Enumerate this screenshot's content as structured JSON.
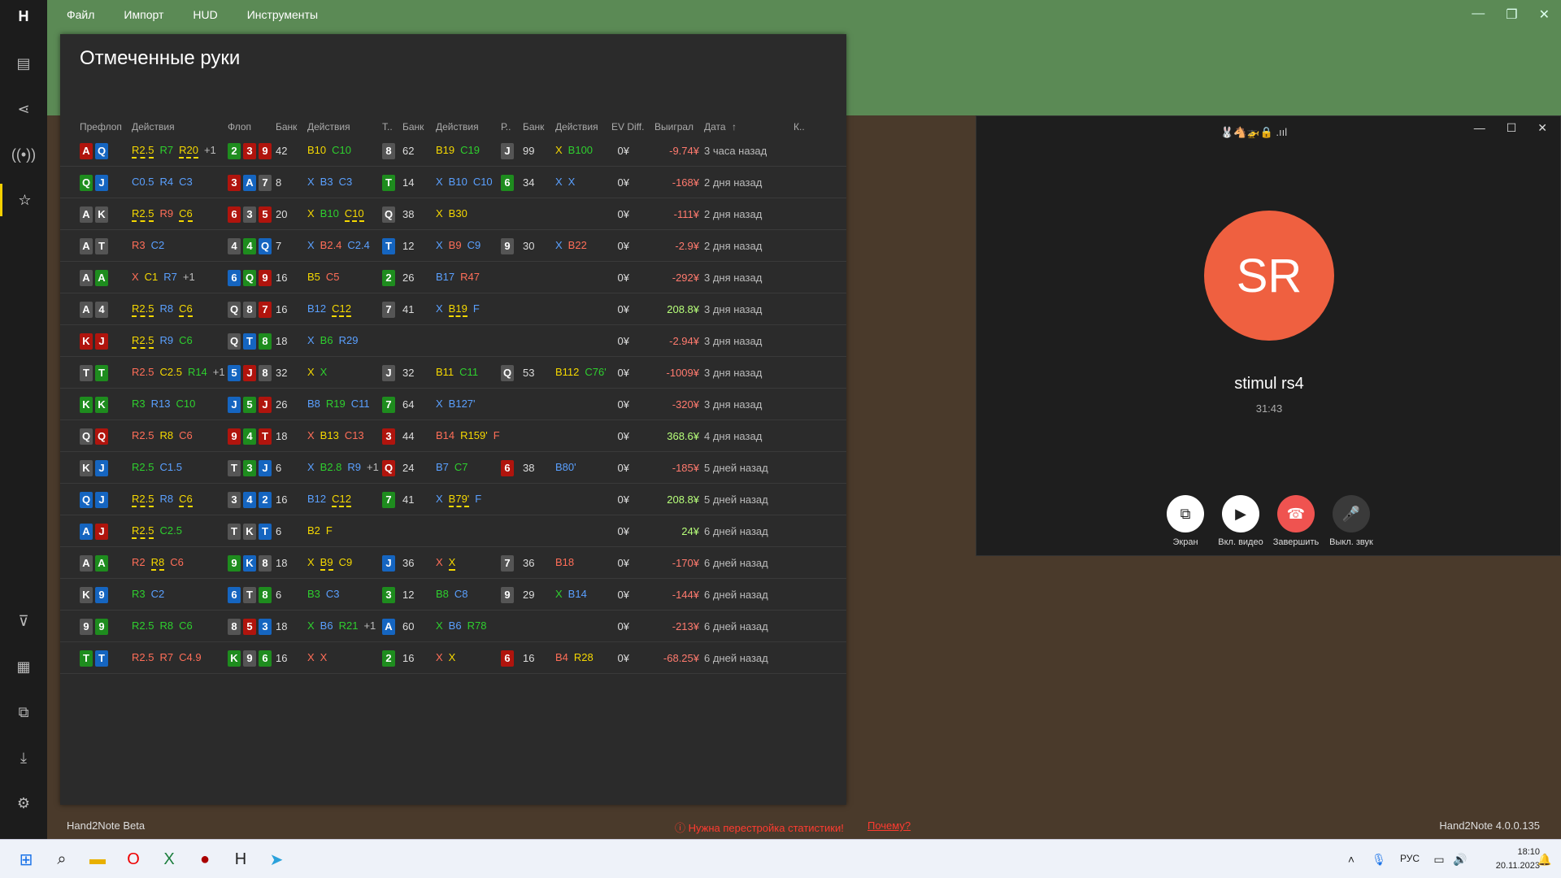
{
  "menu": [
    "Файл",
    "Импорт",
    "HUD",
    "Инструменты"
  ],
  "panel_title": "Отмеченные руки",
  "headers": {
    "preflop": "Префлоп",
    "actions": "Действия",
    "flop": "Флоп",
    "pot": "Банк",
    "t": "Т..",
    "r": "Р..",
    "ev": "EV Diff.",
    "won": "Выиграл",
    "date": "Дата",
    "k": "К.."
  },
  "rows": [
    {
      "hole": [
        [
          "A",
          "r"
        ],
        [
          "Q",
          "b"
        ]
      ],
      "pre": [
        [
          "R2.5",
          "R"
        ],
        [
          "R7",
          "C"
        ],
        [
          "R20",
          "R"
        ],
        [
          "+1",
          "plus"
        ]
      ],
      "flop": [
        [
          "2",
          "g"
        ],
        [
          "3",
          "r"
        ],
        [
          "9",
          "r"
        ]
      ],
      "fpot": "42",
      "fact": [
        [
          "B10",
          "B"
        ],
        [
          "C10",
          "C"
        ]
      ],
      "turn": [
        [
          "8",
          "k"
        ]
      ],
      "tpot": "62",
      "tact": [
        [
          "B19",
          "B"
        ],
        [
          "C19",
          "C"
        ]
      ],
      "river": [
        [
          "J",
          "k"
        ]
      ],
      "rpot": "99",
      "ract": [
        [
          "X",
          "X"
        ],
        [
          "B100",
          "C"
        ]
      ],
      "ev": "0¥",
      "won": "-9.74¥",
      "wsign": "neg",
      "date": "3 часа назад"
    },
    {
      "hole": [
        [
          "Q",
          "g"
        ],
        [
          "J",
          "b"
        ]
      ],
      "pre": [
        [
          "C0.5",
          "blue"
        ],
        [
          "R4",
          "blue"
        ],
        [
          "C3",
          "blue"
        ]
      ],
      "flop": [
        [
          "3",
          "r"
        ],
        [
          "A",
          "b"
        ],
        [
          "7",
          "k"
        ]
      ],
      "fpot": "8",
      "fact": [
        [
          "X",
          "blue"
        ],
        [
          "B3",
          "blue"
        ],
        [
          "C3",
          "blue"
        ]
      ],
      "turn": [
        [
          "T",
          "g"
        ]
      ],
      "tpot": "14",
      "tact": [
        [
          "X",
          "blue"
        ],
        [
          "B10",
          "blue"
        ],
        [
          "C10",
          "blue"
        ]
      ],
      "river": [
        [
          "6",
          "g"
        ]
      ],
      "rpot": "34",
      "ract": [
        [
          "X",
          "blue"
        ],
        [
          "X",
          "blue"
        ]
      ],
      "ev": "0¥",
      "won": "-168¥",
      "wsign": "neg",
      "date": "2 дня назад"
    },
    {
      "hole": [
        [
          "A",
          "k"
        ],
        [
          "K",
          "k"
        ]
      ],
      "pre": [
        [
          "R2.5",
          "R"
        ],
        [
          "R9",
          "red"
        ],
        [
          "C6",
          "R"
        ]
      ],
      "flop": [
        [
          "6",
          "r"
        ],
        [
          "3",
          "k"
        ],
        [
          "5",
          "r"
        ]
      ],
      "fpot": "20",
      "fact": [
        [
          "X",
          "X"
        ],
        [
          "B10",
          "C"
        ],
        [
          "C10",
          "R"
        ]
      ],
      "turn": [
        [
          "Q",
          "k"
        ]
      ],
      "tpot": "38",
      "tact": [
        [
          "X",
          "X"
        ],
        [
          "B30",
          "B"
        ]
      ],
      "river": [],
      "rpot": "",
      "ract": [],
      "ev": "0¥",
      "won": "-111¥",
      "wsign": "neg",
      "date": "2 дня назад"
    },
    {
      "hole": [
        [
          "A",
          "k"
        ],
        [
          "T",
          "k"
        ]
      ],
      "pre": [
        [
          "R3",
          "red"
        ],
        [
          "C2",
          "blue"
        ]
      ],
      "flop": [
        [
          "4",
          "k"
        ],
        [
          "4",
          "g"
        ],
        [
          "Q",
          "b"
        ]
      ],
      "fpot": "7",
      "fact": [
        [
          "X",
          "blue"
        ],
        [
          "B2.4",
          "red"
        ],
        [
          "C2.4",
          "blue"
        ]
      ],
      "turn": [
        [
          "T",
          "b"
        ]
      ],
      "tpot": "12",
      "tact": [
        [
          "X",
          "blue"
        ],
        [
          "B9",
          "red"
        ],
        [
          "C9",
          "blue"
        ]
      ],
      "river": [
        [
          "9",
          "k"
        ]
      ],
      "rpot": "30",
      "ract": [
        [
          "X",
          "blue"
        ],
        [
          "B22",
          "red"
        ]
      ],
      "ev": "0¥",
      "won": "-2.9¥",
      "wsign": "neg",
      "date": "2 дня назад"
    },
    {
      "hole": [
        [
          "A",
          "k"
        ],
        [
          "A",
          "g"
        ]
      ],
      "pre": [
        [
          "X",
          "red"
        ],
        [
          "C1",
          "X"
        ],
        [
          "R7",
          "blue"
        ],
        [
          "+1",
          "plus"
        ]
      ],
      "flop": [
        [
          "6",
          "b"
        ],
        [
          "Q",
          "g"
        ],
        [
          "9",
          "r"
        ]
      ],
      "fpot": "16",
      "fact": [
        [
          "B5",
          "X"
        ],
        [
          "C5",
          "red"
        ]
      ],
      "turn": [
        [
          "2",
          "g"
        ]
      ],
      "tpot": "26",
      "tact": [
        [
          "B17",
          "blue"
        ],
        [
          "R47",
          "red"
        ]
      ],
      "river": [],
      "rpot": "",
      "ract": [],
      "ev": "0¥",
      "won": "-292¥",
      "wsign": "neg",
      "date": "3 дня назад"
    },
    {
      "hole": [
        [
          "A",
          "k"
        ],
        [
          "4",
          "k"
        ]
      ],
      "pre": [
        [
          "R2.5",
          "R"
        ],
        [
          "R8",
          "blue"
        ],
        [
          "C6",
          "R"
        ]
      ],
      "flop": [
        [
          "Q",
          "k"
        ],
        [
          "8",
          "k"
        ],
        [
          "7",
          "r"
        ]
      ],
      "fpot": "16",
      "fact": [
        [
          "B12",
          "blue"
        ],
        [
          "C12",
          "R"
        ]
      ],
      "turn": [
        [
          "7",
          "k"
        ]
      ],
      "tpot": "41",
      "tact": [
        [
          "X",
          "blue"
        ],
        [
          "B19",
          "R"
        ],
        [
          "F",
          "blue"
        ]
      ],
      "river": [],
      "rpot": "",
      "ract": [],
      "ev": "0¥",
      "won": "208.8¥",
      "wsign": "pos",
      "date": "3 дня назад"
    },
    {
      "hole": [
        [
          "K",
          "r"
        ],
        [
          "J",
          "r"
        ]
      ],
      "pre": [
        [
          "R2.5",
          "R"
        ],
        [
          "R9",
          "blue"
        ],
        [
          "C6",
          "C"
        ]
      ],
      "flop": [
        [
          "Q",
          "k"
        ],
        [
          "T",
          "b"
        ],
        [
          "8",
          "g"
        ]
      ],
      "fpot": "18",
      "fact": [
        [
          "X",
          "blue"
        ],
        [
          "B6",
          "C"
        ],
        [
          "R29",
          "blue"
        ]
      ],
      "turn": [],
      "tpot": "",
      "tact": [],
      "river": [],
      "rpot": "",
      "ract": [],
      "ev": "0¥",
      "won": "-2.94¥",
      "wsign": "neg",
      "date": "3 дня назад"
    },
    {
      "hole": [
        [
          "T",
          "k"
        ],
        [
          "T",
          "g"
        ]
      ],
      "pre": [
        [
          "R2.5",
          "red"
        ],
        [
          "C2.5",
          "X"
        ],
        [
          "R14",
          "C"
        ],
        [
          "+1",
          "plus"
        ]
      ],
      "flop": [
        [
          "5",
          "b"
        ],
        [
          "J",
          "r"
        ],
        [
          "8",
          "k"
        ]
      ],
      "fpot": "32",
      "fact": [
        [
          "X",
          "X"
        ],
        [
          "X",
          "C"
        ]
      ],
      "turn": [
        [
          "J",
          "k"
        ]
      ],
      "tpot": "32",
      "tact": [
        [
          "B11",
          "X"
        ],
        [
          "C11",
          "C"
        ]
      ],
      "river": [
        [
          "Q",
          "k"
        ]
      ],
      "rpot": "53",
      "ract": [
        [
          "B112",
          "X"
        ],
        [
          "C76'",
          "C"
        ]
      ],
      "ev": "0¥",
      "won": "-1009¥",
      "wsign": "neg",
      "date": "3 дня назад"
    },
    {
      "hole": [
        [
          "K",
          "g"
        ],
        [
          "K",
          "g"
        ]
      ],
      "pre": [
        [
          "R3",
          "C"
        ],
        [
          "R13",
          "blue"
        ],
        [
          "C10",
          "C"
        ]
      ],
      "flop": [
        [
          "J",
          "b"
        ],
        [
          "5",
          "g"
        ],
        [
          "J",
          "r"
        ]
      ],
      "fpot": "26",
      "fact": [
        [
          "B8",
          "blue"
        ],
        [
          "R19",
          "C"
        ],
        [
          "C11",
          "blue"
        ]
      ],
      "turn": [
        [
          "7",
          "g"
        ]
      ],
      "tpot": "64",
      "tact": [
        [
          "X",
          "blue"
        ],
        [
          "B127'",
          "blue"
        ]
      ],
      "river": [],
      "rpot": "",
      "ract": [],
      "ev": "0¥",
      "won": "-320¥",
      "wsign": "neg",
      "date": "3 дня назад"
    },
    {
      "hole": [
        [
          "Q",
          "k"
        ],
        [
          "Q",
          "r"
        ]
      ],
      "pre": [
        [
          "R2.5",
          "red"
        ],
        [
          "R8",
          "X"
        ],
        [
          "C6",
          "red"
        ]
      ],
      "flop": [
        [
          "9",
          "r"
        ],
        [
          "4",
          "g"
        ],
        [
          "T",
          "r"
        ]
      ],
      "fpot": "18",
      "fact": [
        [
          "X",
          "red"
        ],
        [
          "B13",
          "X"
        ],
        [
          "C13",
          "red"
        ]
      ],
      "turn": [
        [
          "3",
          "r"
        ]
      ],
      "tpot": "44",
      "tact": [
        [
          "B14",
          "red"
        ],
        [
          "R159'",
          "X"
        ],
        [
          "F",
          "red"
        ]
      ],
      "river": [],
      "rpot": "",
      "ract": [],
      "ev": "0¥",
      "won": "368.6¥",
      "wsign": "pos",
      "date": "4 дня назад"
    },
    {
      "hole": [
        [
          "K",
          "k"
        ],
        [
          "J",
          "b"
        ]
      ],
      "pre": [
        [
          "R2.5",
          "C"
        ],
        [
          "C1.5",
          "blue"
        ]
      ],
      "flop": [
        [
          "T",
          "k"
        ],
        [
          "3",
          "g"
        ],
        [
          "J",
          "b"
        ]
      ],
      "fpot": "6",
      "fact": [
        [
          "X",
          "blue"
        ],
        [
          "B2.8",
          "C"
        ],
        [
          "R9",
          "blue"
        ],
        [
          "+1",
          "plus"
        ]
      ],
      "turn": [
        [
          "Q",
          "r"
        ]
      ],
      "tpot": "24",
      "tact": [
        [
          "B7",
          "blue"
        ],
        [
          "C7",
          "C"
        ]
      ],
      "river": [
        [
          "6",
          "r"
        ]
      ],
      "rpot": "38",
      "ract": [
        [
          "B80'",
          "blue"
        ]
      ],
      "ev": "0¥",
      "won": "-185¥",
      "wsign": "neg",
      "date": "5 дней назад"
    },
    {
      "hole": [
        [
          "Q",
          "b"
        ],
        [
          "J",
          "b"
        ]
      ],
      "pre": [
        [
          "R2.5",
          "R"
        ],
        [
          "R8",
          "blue"
        ],
        [
          "C6",
          "R"
        ]
      ],
      "flop": [
        [
          "3",
          "k"
        ],
        [
          "4",
          "b"
        ],
        [
          "2",
          "b"
        ]
      ],
      "fpot": "16",
      "fact": [
        [
          "B12",
          "blue"
        ],
        [
          "C12",
          "R"
        ]
      ],
      "turn": [
        [
          "7",
          "g"
        ]
      ],
      "tpot": "41",
      "tact": [
        [
          "X",
          "blue"
        ],
        [
          "B79'",
          "R"
        ],
        [
          "F",
          "blue"
        ]
      ],
      "river": [],
      "rpot": "",
      "ract": [],
      "ev": "0¥",
      "won": "208.8¥",
      "wsign": "pos",
      "date": "5 дней назад"
    },
    {
      "hole": [
        [
          "A",
          "b"
        ],
        [
          "J",
          "r"
        ]
      ],
      "pre": [
        [
          "R2.5",
          "R"
        ],
        [
          "C2.5",
          "C"
        ]
      ],
      "flop": [
        [
          "T",
          "k"
        ],
        [
          "K",
          "k"
        ],
        [
          "T",
          "b"
        ]
      ],
      "fpot": "6",
      "fact": [
        [
          "B2",
          "X"
        ],
        [
          "F",
          "X"
        ]
      ],
      "turn": [],
      "tpot": "",
      "tact": [],
      "river": [],
      "rpot": "",
      "ract": [],
      "ev": "0¥",
      "won": "24¥",
      "wsign": "pos",
      "date": "6 дней назад"
    },
    {
      "hole": [
        [
          "A",
          "k"
        ],
        [
          "A",
          "g"
        ]
      ],
      "pre": [
        [
          "R2",
          "red"
        ],
        [
          "R8",
          "R"
        ],
        [
          "C6",
          "red"
        ]
      ],
      "flop": [
        [
          "9",
          "g"
        ],
        [
          "K",
          "b"
        ],
        [
          "8",
          "k"
        ]
      ],
      "fpot": "18",
      "fact": [
        [
          "X",
          "X"
        ],
        [
          "B9",
          "R"
        ],
        [
          "C9",
          "X"
        ]
      ],
      "turn": [
        [
          "J",
          "b"
        ]
      ],
      "tpot": "36",
      "tact": [
        [
          "X",
          "red"
        ],
        [
          "X",
          "R"
        ]
      ],
      "river": [
        [
          "7",
          "k"
        ]
      ],
      "rpot": "36",
      "ract": [
        [
          "B18",
          "red"
        ]
      ],
      "ev": "0¥",
      "won": "-170¥",
      "wsign": "neg",
      "date": "6 дней назад"
    },
    {
      "hole": [
        [
          "K",
          "k"
        ],
        [
          "9",
          "b"
        ]
      ],
      "pre": [
        [
          "R3",
          "C"
        ],
        [
          "C2",
          "blue"
        ]
      ],
      "flop": [
        [
          "6",
          "b"
        ],
        [
          "T",
          "k"
        ],
        [
          "8",
          "g"
        ]
      ],
      "fpot": "6",
      "fact": [
        [
          "B3",
          "C"
        ],
        [
          "C3",
          "blue"
        ]
      ],
      "turn": [
        [
          "3",
          "g"
        ]
      ],
      "tpot": "12",
      "tact": [
        [
          "B8",
          "C"
        ],
        [
          "C8",
          "blue"
        ]
      ],
      "river": [
        [
          "9",
          "k"
        ]
      ],
      "rpot": "29",
      "ract": [
        [
          "X",
          "C"
        ],
        [
          "B14",
          "blue"
        ]
      ],
      "ev": "0¥",
      "won": "-144¥",
      "wsign": "neg",
      "date": "6 дней назад"
    },
    {
      "hole": [
        [
          "9",
          "k"
        ],
        [
          "9",
          "g"
        ]
      ],
      "pre": [
        [
          "R2.5",
          "C"
        ],
        [
          "R8",
          "C"
        ],
        [
          "C6",
          "C"
        ]
      ],
      "flop": [
        [
          "8",
          "k"
        ],
        [
          "5",
          "r"
        ],
        [
          "3",
          "b"
        ]
      ],
      "fpot": "18",
      "fact": [
        [
          "X",
          "C"
        ],
        [
          "B6",
          "blue"
        ],
        [
          "R21",
          "C"
        ],
        [
          "+1",
          "plus"
        ]
      ],
      "turn": [
        [
          "A",
          "b"
        ]
      ],
      "tpot": "60",
      "tact": [
        [
          "X",
          "C"
        ],
        [
          "B6",
          "blue"
        ],
        [
          "R78",
          "C"
        ]
      ],
      "river": [],
      "rpot": "",
      "ract": [],
      "ev": "0¥",
      "won": "-213¥",
      "wsign": "neg",
      "date": "6 дней назад"
    },
    {
      "hole": [
        [
          "T",
          "g"
        ],
        [
          "T",
          "b"
        ]
      ],
      "pre": [
        [
          "R2.5",
          "red"
        ],
        [
          "R7",
          "red"
        ],
        [
          "C4.9",
          "red"
        ]
      ],
      "flop": [
        [
          "K",
          "g"
        ],
        [
          "9",
          "k"
        ],
        [
          "6",
          "g"
        ]
      ],
      "fpot": "16",
      "fact": [
        [
          "X",
          "red"
        ],
        [
          "X",
          "red"
        ]
      ],
      "turn": [
        [
          "2",
          "g"
        ]
      ],
      "tpot": "16",
      "tact": [
        [
          "X",
          "red"
        ],
        [
          "X",
          "X"
        ]
      ],
      "river": [
        [
          "6",
          "r"
        ]
      ],
      "rpot": "16",
      "ract": [
        [
          "B4",
          "red"
        ],
        [
          "R28",
          "X"
        ]
      ],
      "ev": "0¥",
      "won": "-68.25¥",
      "wsign": "neg",
      "date": "6 дней назад"
    }
  ],
  "footer": {
    "left": "Hand2Note Beta",
    "warning": "ⓘ Нужна перестройка статистики!",
    "why": "Почему?",
    "version": "Hand2Note 4.0.0.135"
  },
  "call": {
    "initials": "SR",
    "name": "stimul rs4",
    "timer": "31:43",
    "status_icons": "🐰🐴🚁🔒 .ııl",
    "btn_screen": "Экран",
    "btn_video": "Вкл. видео",
    "btn_end": "Завершить",
    "btn_mute": "Выкл. звук"
  },
  "tray": {
    "lang": "РУС",
    "time": "18:10",
    "date": "20.11.2023"
  }
}
